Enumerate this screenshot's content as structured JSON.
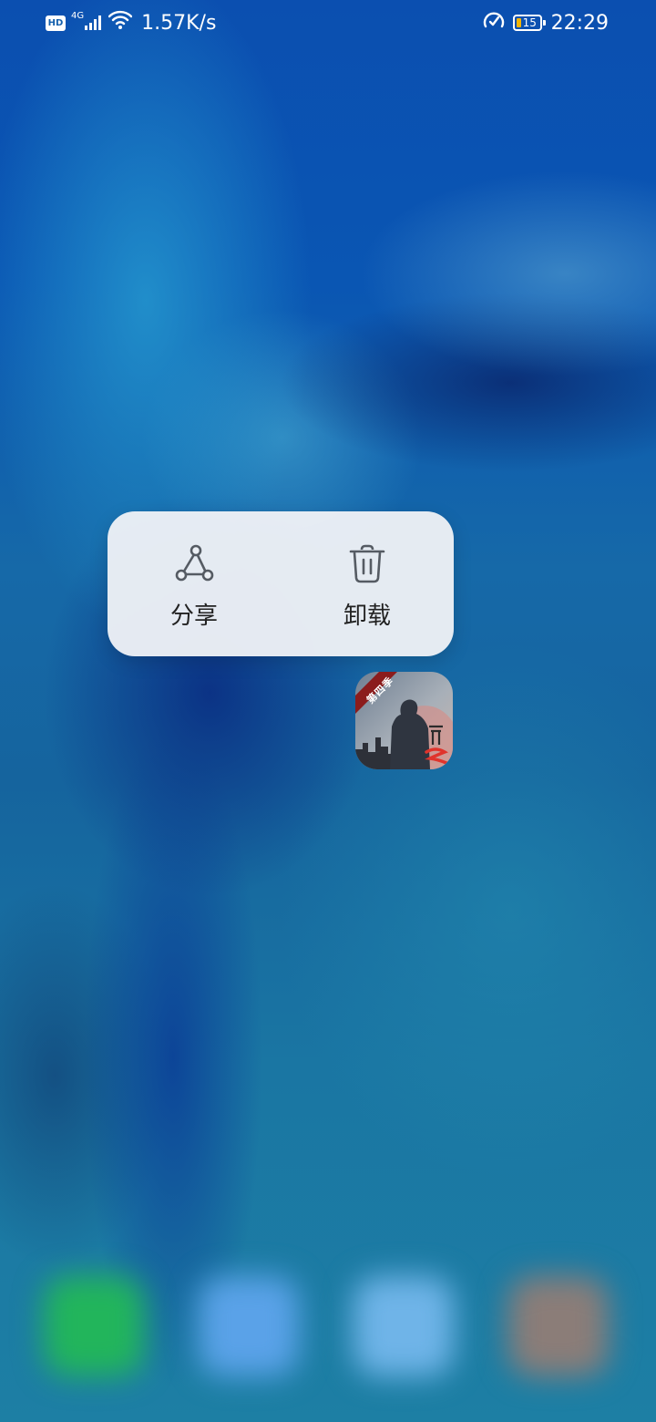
{
  "status_bar": {
    "hd_label": "HD",
    "network_type": "4G",
    "net_speed": "1.57K/s",
    "battery_level": "15",
    "time": "22:29",
    "icons": [
      "hd-icon",
      "signal-icon",
      "wifi-icon",
      "boost-icon",
      "battery-icon"
    ]
  },
  "context_menu": {
    "items": [
      {
        "label": "分享",
        "icon": "share-icon"
      },
      {
        "label": "卸载",
        "icon": "trash-icon"
      }
    ]
  },
  "selected_app": {
    "badge": "第四季",
    "icon": "app-icon-game"
  },
  "dock": {
    "icons": [
      "phone-icon",
      "messages-icon",
      "browser-icon",
      "camera-icon"
    ]
  },
  "colors": {
    "menu_background": "#ecf0f5",
    "menu_text": "#222222",
    "icon_stroke": "#555b63",
    "battery_fill": "#f5b400",
    "app_badge": "#8b1c1c",
    "app_brand_red": "#e0342c"
  }
}
